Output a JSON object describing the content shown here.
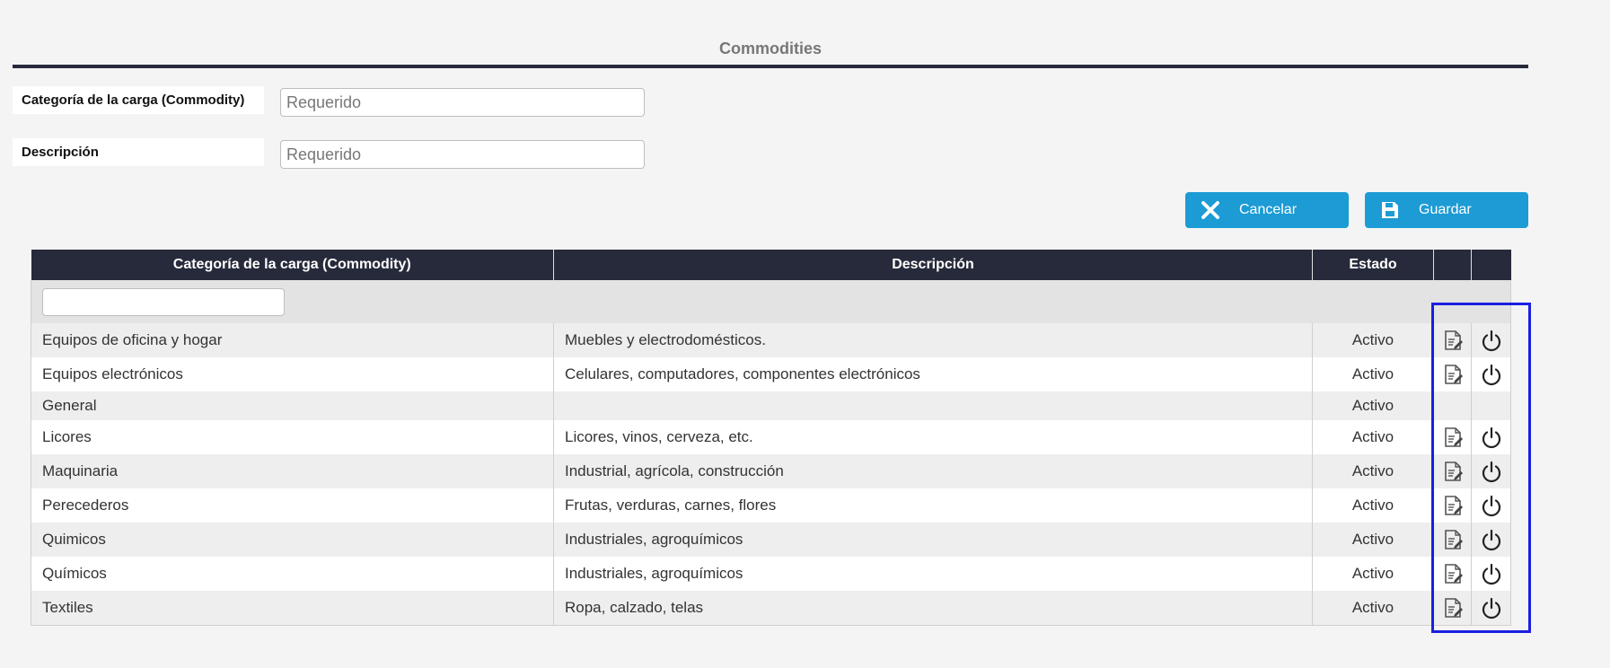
{
  "section": {
    "title": "Commodities"
  },
  "form": {
    "category": {
      "label": "Categoría de la carga (Commodity)",
      "placeholder": "Requerido",
      "value": ""
    },
    "description": {
      "label": "Descripción",
      "placeholder": "Requerido",
      "value": ""
    }
  },
  "buttons": {
    "cancel": {
      "label": "Cancelar",
      "icon": "close-icon"
    },
    "save": {
      "label": "Guardar",
      "icon": "floppy-disk-icon"
    }
  },
  "table": {
    "headers": [
      "Categoría de la carga (Commodity)",
      "Descripción",
      "Estado",
      "",
      ""
    ],
    "filter": {
      "value": ""
    },
    "rows": [
      {
        "category": "Equipos de oficina y hogar",
        "description": "Muebles y electrodomésticos.",
        "status": "Activo",
        "actions": true
      },
      {
        "category": "Equipos electrónicos",
        "description": "Celulares, computadores, componentes electrónicos",
        "status": "Activo",
        "actions": true
      },
      {
        "category": "General",
        "description": "",
        "status": "Activo",
        "actions": false
      },
      {
        "category": "Licores",
        "description": "Licores, vinos, cerveza, etc.",
        "status": "Activo",
        "actions": true
      },
      {
        "category": "Maquinaria",
        "description": "Industrial, agrícola, construcción",
        "status": "Activo",
        "actions": true
      },
      {
        "category": "Perecederos",
        "description": "Frutas, verduras, carnes, flores",
        "status": "Activo",
        "actions": true
      },
      {
        "category": "Quimicos",
        "description": "Industriales, agroquímicos",
        "status": "Activo",
        "actions": true
      },
      {
        "category": "Químicos",
        "description": "Industriales, agroquímicos",
        "status": "Activo",
        "actions": true
      },
      {
        "category": "Textiles",
        "description": "Ropa, calzado, telas",
        "status": "Activo",
        "actions": true
      }
    ],
    "action_icons": {
      "edit": "edit-document-icon",
      "toggle": "power-icon"
    }
  },
  "colors": {
    "header_bg": "#272a3b",
    "button_bg": "#1c9bd5",
    "highlight": "#1a1fe0"
  }
}
